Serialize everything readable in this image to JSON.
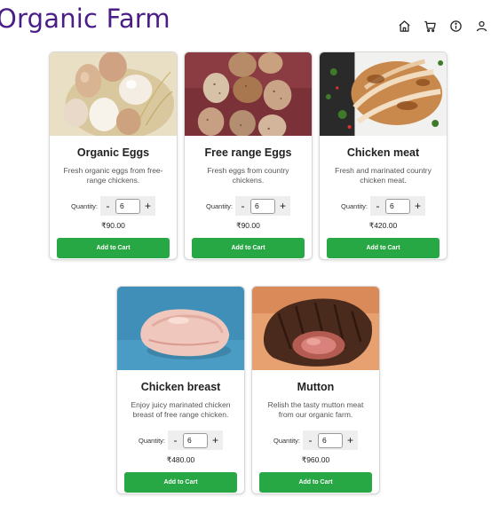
{
  "brand": {
    "title": "Organic Farm"
  },
  "nav": {
    "icons": [
      "home-icon",
      "cart-icon",
      "info-icon",
      "user-icon"
    ]
  },
  "colors": {
    "brand": "#4b1e87",
    "button": "#28a745"
  },
  "products": [
    {
      "name": "Organic Eggs",
      "description": "Fresh organic eggs from free-range chickens.",
      "quantity_label": "Quantity:",
      "quantity": "6",
      "minus": "-",
      "plus": "+",
      "price": "₹90.00",
      "button": "Add to Cart",
      "image": "eggs-photo"
    },
    {
      "name": "Free range Eggs",
      "description": "Fresh eggs from country chickens.",
      "quantity_label": "Quantity:",
      "quantity": "6",
      "minus": "-",
      "plus": "+",
      "price": "₹90.00",
      "button": "Add to Cart",
      "image": "speckled-eggs-photo"
    },
    {
      "name": "Chicken meat",
      "description": "Fresh and marinated country chicken meat.",
      "quantity_label": "Quantity:",
      "quantity": "6",
      "minus": "-",
      "plus": "+",
      "price": "₹420.00",
      "button": "Add to Cart",
      "image": "chicken-meat-photo"
    },
    {
      "name": "Chicken breast",
      "description": "Enjoy juicy marinated chicken breast of free range chicken.",
      "quantity_label": "Quantity:",
      "quantity": "6",
      "minus": "-",
      "plus": "+",
      "price": "₹480.00",
      "button": "Add to Cart",
      "image": "chicken-breast-photo"
    },
    {
      "name": "Mutton",
      "description": "Relish the tasty mutton meat from our organic farm.",
      "quantity_label": "Quantity:",
      "quantity": "6",
      "minus": "-",
      "plus": "+",
      "price": "₹960.00",
      "button": "Add to Cart",
      "image": "mutton-photo"
    }
  ]
}
